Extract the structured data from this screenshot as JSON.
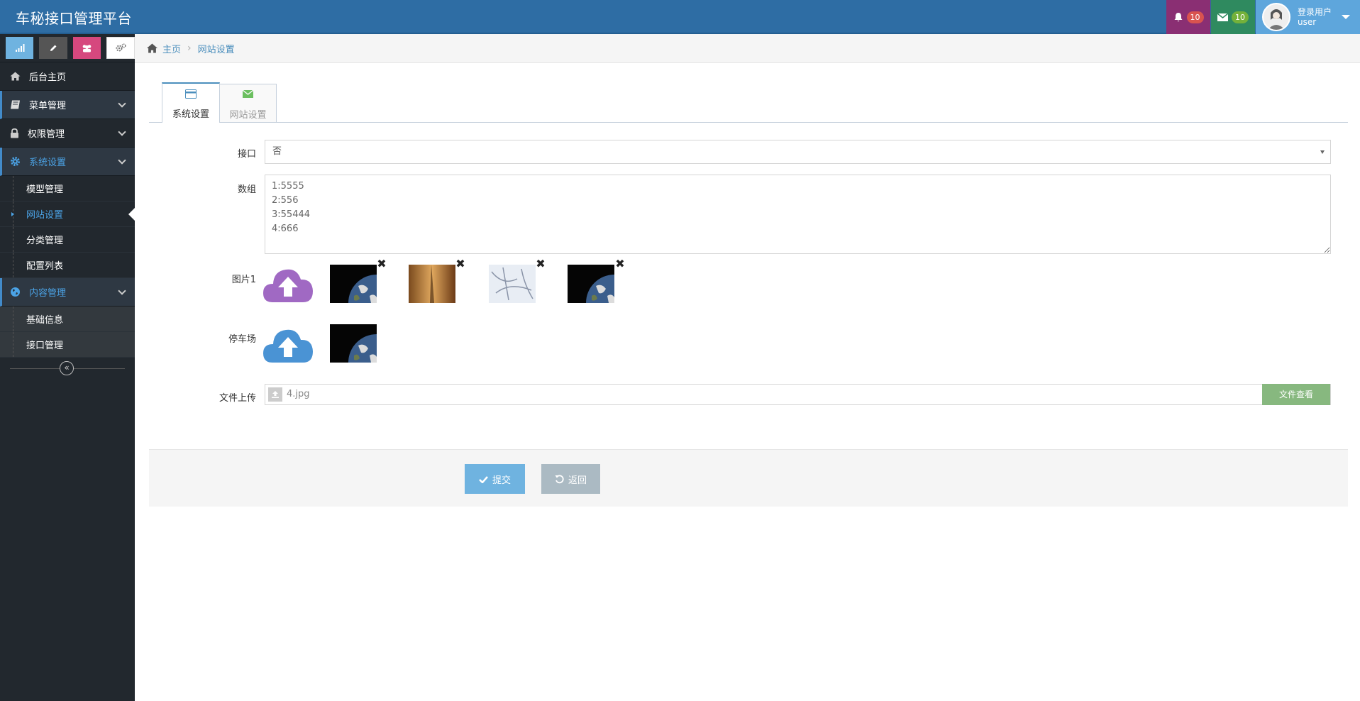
{
  "header": {
    "brand": "车秘接口管理平台",
    "notifications_count": "10",
    "messages_count": "10",
    "user_label": "登录用户",
    "user_name": "user"
  },
  "sidebar": {
    "shortcut_colors": [
      "#6fb3e0",
      "#555555",
      "#d6487e",
      "#ffffff"
    ],
    "items": [
      {
        "label": "后台主页",
        "icon": "home-icon"
      },
      {
        "label": "菜单管理",
        "icon": "book-icon"
      },
      {
        "label": "权限管理",
        "icon": "lock-icon"
      },
      {
        "label": "系统设置",
        "icon": "gear-icon"
      },
      {
        "label": "内容管理",
        "icon": "globe-icon"
      }
    ],
    "sub_system": [
      "模型管理",
      "网站设置",
      "分类管理",
      "配置列表"
    ],
    "sub_content": [
      "基础信息",
      "接口管理"
    ]
  },
  "breadcrumb": {
    "home": "主页",
    "current": "网站设置"
  },
  "tabs": [
    {
      "label": "系统设置",
      "icon": "credit-card-icon"
    },
    {
      "label": "网站设置",
      "icon": "envelope-icon"
    }
  ],
  "form": {
    "interface_label": "接口",
    "interface_value": "否",
    "array_label": "数组",
    "array_value": "1:5555\n2:556\n3:55444\n4:666",
    "image1_label": "图片1",
    "parking_label": "停车场",
    "file_label": "文件上传",
    "file_name": "4.jpg",
    "file_view_button": "文件查看",
    "submit_label": "提交",
    "back_label": "返回"
  },
  "colors": {
    "topbar": "#2e6da4",
    "sidebar": "#22282e",
    "accent": "#4c8fbd",
    "upload_purple": "#a069c3",
    "upload_blue": "#4a93d4"
  }
}
